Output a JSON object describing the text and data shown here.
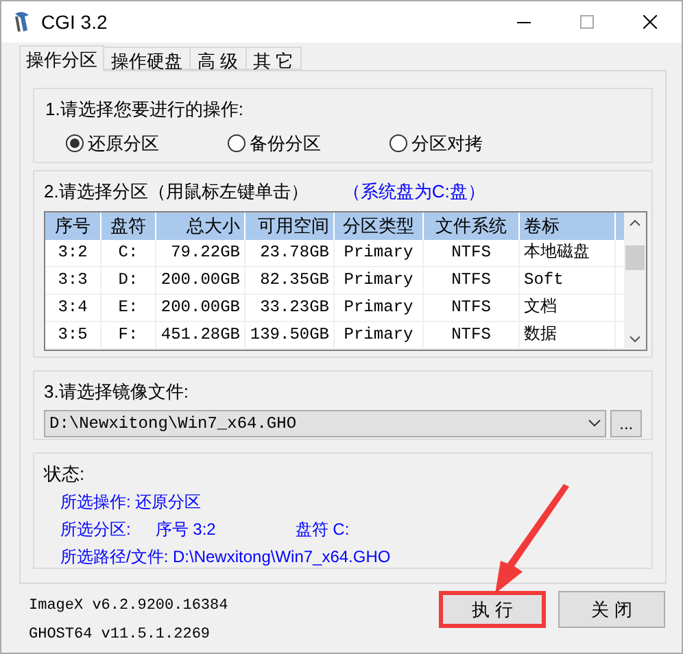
{
  "window": {
    "title": "CGI 3.2"
  },
  "tabs": [
    {
      "label": "操作分区",
      "selected": true
    },
    {
      "label": "操作硬盘",
      "selected": false
    },
    {
      "label": "高 级",
      "selected": false
    },
    {
      "label": "其 它",
      "selected": false
    }
  ],
  "operation": {
    "label": "1.请选择您要进行的操作:",
    "options": [
      {
        "label": "还原分区",
        "selected": true
      },
      {
        "label": "备份分区",
        "selected": false
      },
      {
        "label": "分区对拷",
        "selected": false
      }
    ]
  },
  "partition": {
    "label": "2.请选择分区（用鼠标左键单击）",
    "note": "（系统盘为C:盘）",
    "columns": [
      "序号",
      "盘符",
      "总大小",
      "可用空间",
      "分区类型",
      "文件系统",
      "卷标"
    ],
    "rows": [
      [
        "3:2",
        "C:",
        "79.22GB",
        "23.78GB",
        "Primary",
        "NTFS",
        "本地磁盘"
      ],
      [
        "3:3",
        "D:",
        "200.00GB",
        "82.35GB",
        "Primary",
        "NTFS",
        "Soft"
      ],
      [
        "3:4",
        "E:",
        "200.00GB",
        "33.23GB",
        "Primary",
        "NTFS",
        "文档"
      ],
      [
        "3:5",
        "F:",
        "451.28GB",
        "139.50GB",
        "Primary",
        "NTFS",
        "数据"
      ]
    ]
  },
  "image": {
    "label": "3.请选择镜像文件:",
    "value": "D:\\Newxitong\\Win7_x64.GHO",
    "browse": "..."
  },
  "status": {
    "label": "状态:",
    "lines": [
      [
        "所选操作: 还原分区"
      ],
      [
        "所选分区:",
        "序号 3:2",
        "盘符 C:"
      ],
      [
        "所选路径/文件: D:\\Newxitong\\Win7_x64.GHO"
      ]
    ]
  },
  "versions": [
    "ImageX v6.2.9200.16384",
    "GHOST64 v11.5.1.2269"
  ],
  "buttons": [
    {
      "label": "执 行",
      "annotated": true
    },
    {
      "label": "关 闭",
      "annotated": false
    }
  ]
}
